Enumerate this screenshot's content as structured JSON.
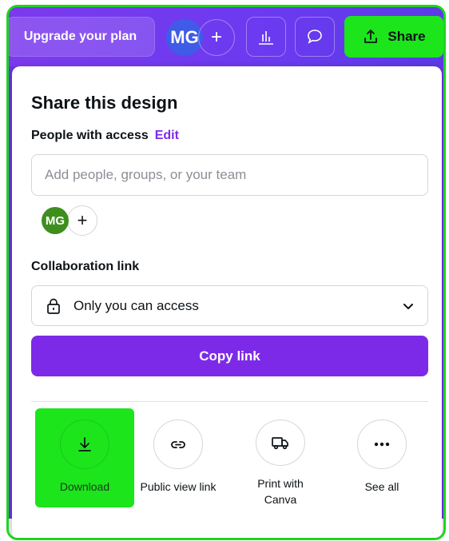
{
  "topbar": {
    "upgrade_label": "Upgrade your plan",
    "avatar_initials": "MG",
    "add_label": "+",
    "share_label": "Share"
  },
  "share_panel": {
    "title": "Share this design",
    "people_label": "People with access",
    "edit_label": "Edit",
    "people_input": {
      "value": "",
      "placeholder": "Add people, groups, or your team"
    },
    "member_initials": "MG",
    "add_member_label": "+",
    "collab_label": "Collaboration link",
    "access_option": "Only you can access",
    "copy_link_label": "Copy link",
    "actions": [
      {
        "label": "Download",
        "icon": "download-icon"
      },
      {
        "label": "Public view link",
        "icon": "link-icon"
      },
      {
        "label": "Print with Canva",
        "icon": "truck-icon"
      },
      {
        "label": "See all",
        "icon": "more-icon"
      }
    ]
  },
  "colors": {
    "brand_purple": "#7d2ae8",
    "highlight_green": "#1ce51c",
    "avatar_blue": "#3f5be8",
    "avatar_green": "#3e8e1e"
  }
}
